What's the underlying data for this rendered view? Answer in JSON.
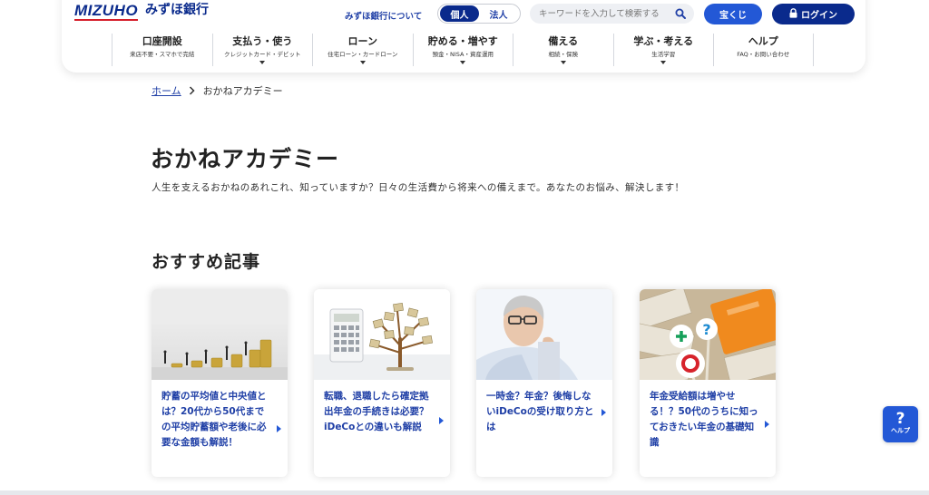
{
  "header": {
    "logo_mark": "MIZUHO",
    "logo_name": "みずほ銀行",
    "about_link": "みずほ銀行について",
    "segment": {
      "personal": "個人",
      "corporate": "法人",
      "selected": "個人"
    },
    "search": {
      "placeholder": "キーワードを入力して検索する"
    },
    "lottery_button": "宝くじ",
    "login_button": "ログイン"
  },
  "nav": {
    "items": [
      {
        "label": "口座開設",
        "sub": "来店不要・スマホで完結",
        "has_menu": false
      },
      {
        "label": "支払う・使う",
        "sub": "クレジットカード・デビット",
        "has_menu": true
      },
      {
        "label": "ローン",
        "sub": "住宅ローン・カードローン",
        "has_menu": true
      },
      {
        "label": "貯める・増やす",
        "sub": "預金・NISA・資産運用",
        "has_menu": true
      },
      {
        "label": "備える",
        "sub": "相続・保険",
        "has_menu": true
      },
      {
        "label": "学ぶ・考える",
        "sub": "生活学習",
        "has_menu": true
      },
      {
        "label": "ヘルプ",
        "sub": "FAQ・お問い合わせ",
        "has_menu": false
      }
    ]
  },
  "breadcrumb": {
    "home": "ホーム",
    "current": "おかねアカデミー"
  },
  "page": {
    "title": "おかねアカデミー",
    "description": "人生を支えるおかねのあれこれ、知っていますか？日々の生活費から将来への備えまで。あなたのお悩み、解決します！"
  },
  "recommended": {
    "title": "おすすめ記事",
    "cards": [
      {
        "text": "貯蓄の平均値と中央値とは？20代から50代までの平均貯蓄額や老後に必要な金額も解説！",
        "image": "coins-and-figures"
      },
      {
        "text": "転職、退職したら確定拠出年金の手続きは必要？iDeCoとの違いも解説",
        "image": "calculator-and-money-tree"
      },
      {
        "text": "一時金？年金？後悔しないiDeCoの受け取り方とは",
        "image": "elderly-man-thinking"
      },
      {
        "text": "年金受給額は増やせる！？50代のうちに知っておきたい年金の基礎知識",
        "image": "pension-book-and-cash"
      }
    ]
  },
  "help": {
    "icon": "?",
    "label": "ヘルプ"
  },
  "colors": {
    "brand_navy": "#0a2a8c",
    "brand_blue": "#2358d6",
    "link_blue": "#1f3fa6",
    "brand_red": "#d51f2b"
  }
}
